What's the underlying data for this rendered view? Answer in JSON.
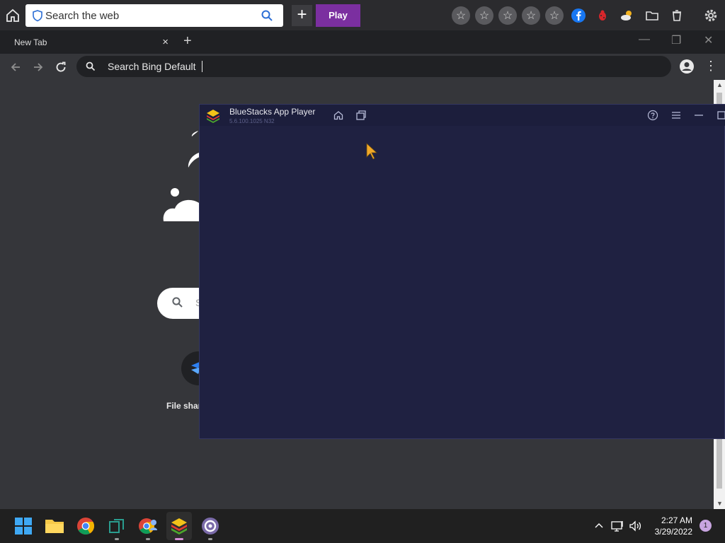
{
  "topbar": {
    "search_placeholder": "Search the web",
    "play_label": "Play",
    "icons": [
      "home-icon",
      "shield-icon",
      "search-icon",
      "plus-icon",
      "star-icon",
      "facebook-icon",
      "bug-icon",
      "weather-icon",
      "folder-icon",
      "trash-icon",
      "gear-icon"
    ],
    "accent_color": "#7b2fa0"
  },
  "browser": {
    "tab_title": "New Tab",
    "tab_close": "×",
    "newtab_symbol": "+",
    "omnibox_text": "Search Bing Default",
    "ntp_search_placeholder": "S",
    "shortcut_label": "File shar"
  },
  "bluestacks": {
    "app_name": "BlueStacks App Player",
    "version": "5.6.100.1025  N32"
  },
  "taskbar": {
    "time": "2:27 AM",
    "date": "3/29/2022",
    "notification_count": "1",
    "apps": [
      "start-icon",
      "file-explorer-icon",
      "chrome-icon",
      "bluestacks-multi-instance-icon",
      "chrome-profile-icon",
      "bluestacks-icon",
      "app-icon"
    ]
  }
}
